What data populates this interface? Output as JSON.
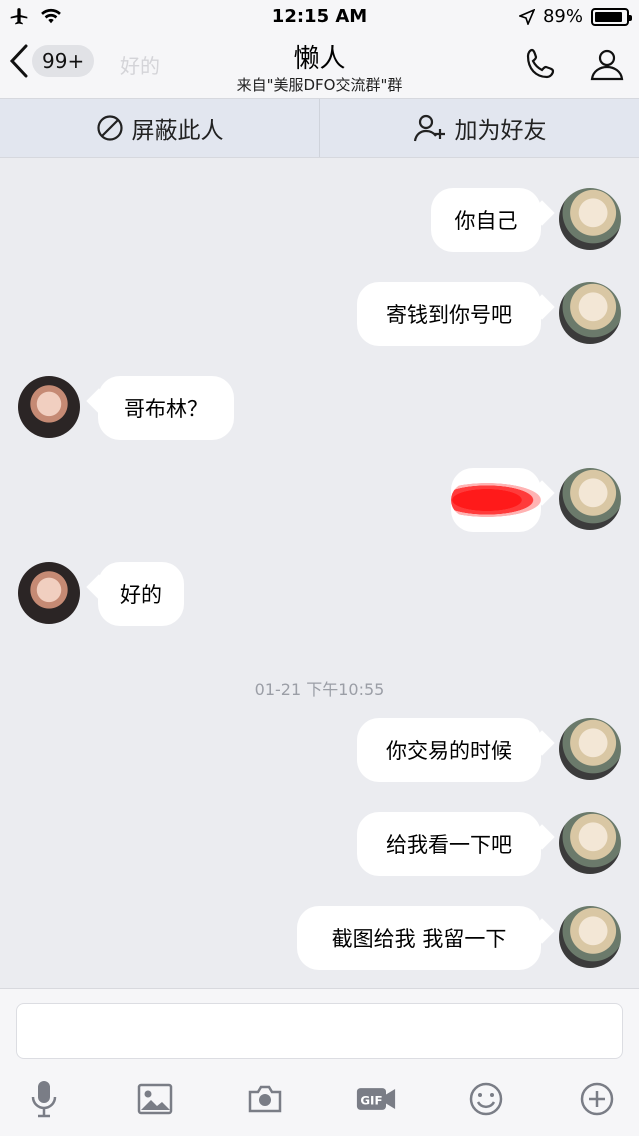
{
  "status_bar": {
    "time": "12:15 AM",
    "battery": "89%",
    "battery_level": 0.89
  },
  "nav": {
    "back_badge": "99+",
    "ghost_preview": "好的",
    "title": "懒人",
    "subtitle": "来自\"美服DFO交流群\"群",
    "call_icon": "phone-icon",
    "profile_icon": "person-icon"
  },
  "actions": {
    "block_label": "屏蔽此人",
    "add_friend_label": "加为好友"
  },
  "messages": [
    {
      "side": "me",
      "text": "你自己"
    },
    {
      "side": "me",
      "text": "寄钱到你号吧"
    },
    {
      "side": "other",
      "text": "哥布林？"
    },
    {
      "side": "me",
      "text": "",
      "redacted": true
    },
    {
      "side": "other",
      "text": "好的"
    },
    {
      "type": "timestamp",
      "text": "01-21 下午10:55"
    },
    {
      "side": "me",
      "text": "你交易的时候"
    },
    {
      "side": "me",
      "text": "给我看一下吧"
    },
    {
      "side": "me",
      "text": "截图给我  我留一下"
    }
  ],
  "toolbar_icons": [
    "microphone-icon",
    "image-icon",
    "camera-icon",
    "gif-icon",
    "emoji-icon",
    "plus-icon"
  ]
}
